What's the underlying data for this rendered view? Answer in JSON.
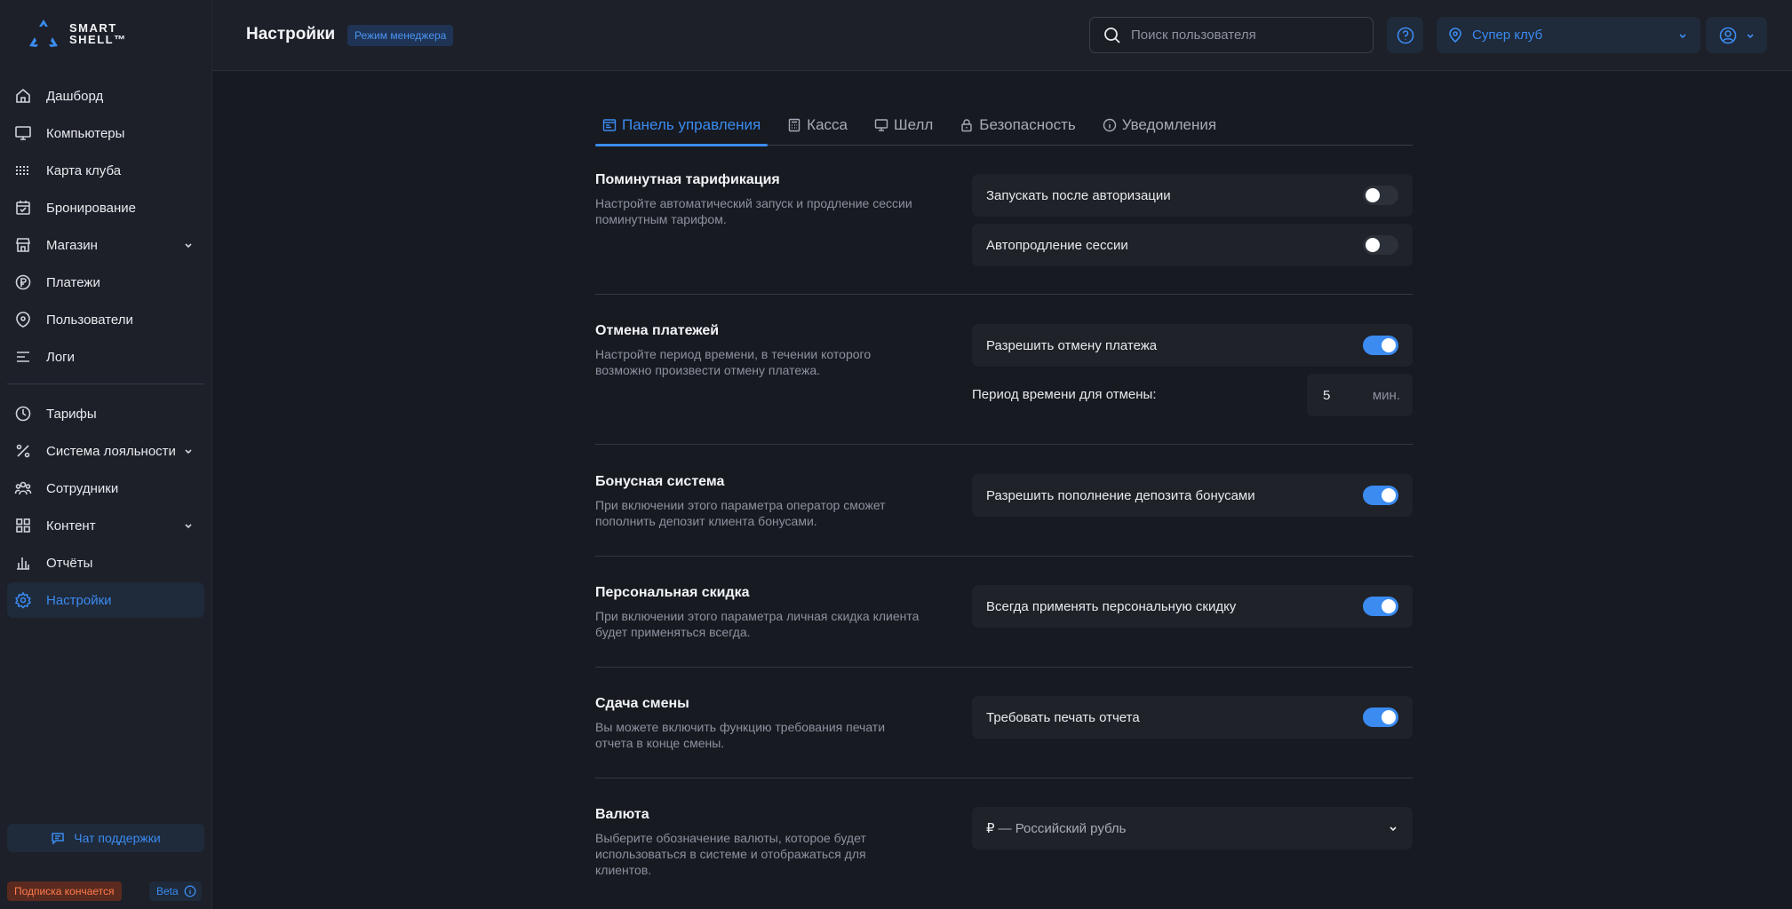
{
  "app": {
    "logo_line1": "SMART",
    "logo_line2": "SHELL™"
  },
  "header": {
    "title": "Настройки",
    "mode_badge": "Режим менеджера",
    "search_placeholder": "Поиск пользователя",
    "club": "Супер клуб"
  },
  "sidebar": {
    "items": [
      {
        "label": "Дашборд",
        "icon": "home-icon"
      },
      {
        "label": "Компьютеры",
        "icon": "monitor-icon"
      },
      {
        "label": "Карта клуба",
        "icon": "grid-dots-icon"
      },
      {
        "label": "Бронирование",
        "icon": "calendar-check-icon"
      },
      {
        "label": "Магазин",
        "icon": "store-icon",
        "expandable": true
      },
      {
        "label": "Платежи",
        "icon": "ruble-circle-icon"
      },
      {
        "label": "Пользователи",
        "icon": "user-shield-icon"
      },
      {
        "label": "Логи",
        "icon": "list-lines-icon"
      },
      {
        "label": "Тарифы",
        "icon": "clock-icon"
      },
      {
        "label": "Система лояльности",
        "icon": "percent-icon",
        "expandable": true
      },
      {
        "label": "Сотрудники",
        "icon": "team-icon"
      },
      {
        "label": "Контент",
        "icon": "blocks-icon",
        "expandable": true
      },
      {
        "label": "Отчёты",
        "icon": "bar-chart-icon"
      },
      {
        "label": "Настройки",
        "icon": "gear-icon",
        "active": true
      }
    ],
    "support_button": "Чат поддержки",
    "subscription_badge": "Подписка кончается",
    "beta_badge": "Beta"
  },
  "tabs": [
    {
      "label": "Панель управления",
      "icon": "dashboard-panel-icon",
      "active": true
    },
    {
      "label": "Касса",
      "icon": "calculator-icon"
    },
    {
      "label": "Шелл",
      "icon": "monitor-icon"
    },
    {
      "label": "Безопасность",
      "icon": "lock-icon"
    },
    {
      "label": "Уведомления",
      "icon": "info-icon"
    }
  ],
  "sections": {
    "minute_billing": {
      "title": "Поминутная тарификация",
      "desc": "Настройте автоматический запуск и продление сессии поминутным тарифом.",
      "options": [
        {
          "label": "Запускать после авторизации",
          "enabled": false
        },
        {
          "label": "Автопродление сессии",
          "enabled": false
        }
      ]
    },
    "payment_cancel": {
      "title": "Отмена платежей",
      "desc": "Настройте период времени, в течении которого возможно произвести отмену платежа.",
      "option": {
        "label": "Разрешить отмену платежа",
        "enabled": true
      },
      "period_label": "Период времени для отмены:",
      "period_value": "5",
      "period_unit": "мин."
    },
    "bonus": {
      "title": "Бонусная система",
      "desc": "При включении этого параметра оператор сможет пополнить депозит клиента бонусами.",
      "option": {
        "label": "Разрешить пополнение депозита бонусами",
        "enabled": true
      }
    },
    "discount": {
      "title": "Персональная скидка",
      "desc": "При включении этого параметра личная скидка клиента будет применяться всегда.",
      "option": {
        "label": "Всегда применять персональную скидку",
        "enabled": true
      }
    },
    "shift": {
      "title": "Сдача смены",
      "desc": "Вы можете включить функцию требования печати отчета в конце смены.",
      "option": {
        "label": "Требовать печать отчета",
        "enabled": true
      }
    },
    "currency": {
      "title": "Валюта",
      "desc": "Выберите обозначение валюты, которое будет использоваться в системе и отображаться для клиентов.",
      "symbol": "₽",
      "value": "— Российский рубль"
    }
  },
  "colors": {
    "accent": "#3b8bf0",
    "background": "#171a21",
    "panel": "#1d2028",
    "row": "#1f2229",
    "warning": "#ff7a4d"
  }
}
